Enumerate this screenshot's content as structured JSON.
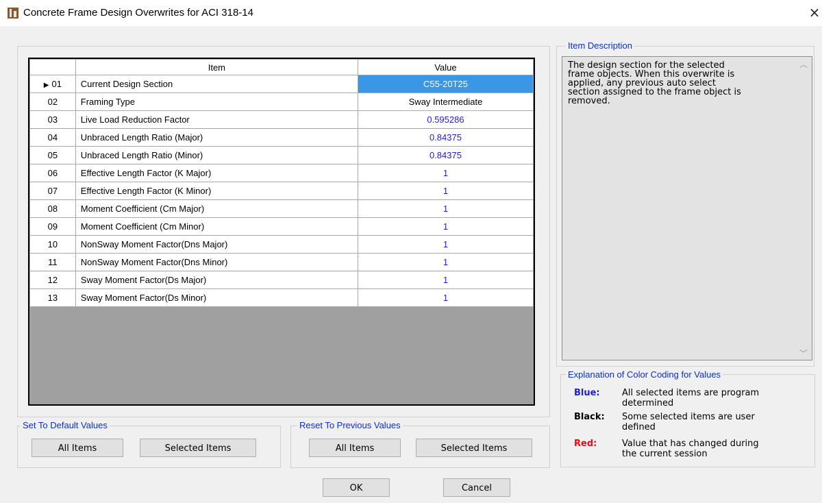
{
  "window": {
    "title": "Concrete Frame Design Overwrites for ACI 318-14",
    "close_glyph": "×"
  },
  "grid": {
    "header": {
      "num": "",
      "item": "Item",
      "value": "Value"
    },
    "selected_marker": "▶",
    "rows": [
      {
        "num": "01",
        "item": "Current Design Section",
        "value": "C55-20T25",
        "color": "blue",
        "selected": true
      },
      {
        "num": "02",
        "item": "Framing Type",
        "value": "Sway Intermediate",
        "color": "black"
      },
      {
        "num": "03",
        "item": "Live Load Reduction Factor",
        "value": "0.595286",
        "color": "blue"
      },
      {
        "num": "04",
        "item": "Unbraced Length Ratio (Major)",
        "value": "0.84375",
        "color": "blue"
      },
      {
        "num": "05",
        "item": "Unbraced Length Ratio (Minor)",
        "value": "0.84375",
        "color": "blue"
      },
      {
        "num": "06",
        "item": "Effective Length Factor (K Major)",
        "value": "1",
        "color": "blue"
      },
      {
        "num": "07",
        "item": "Effective Length Factor (K Minor)",
        "value": "1",
        "color": "blue"
      },
      {
        "num": "08",
        "item": "Moment Coefficient (Cm Major)",
        "value": "1",
        "color": "blue"
      },
      {
        "num": "09",
        "item": "Moment Coefficient (Cm Minor)",
        "value": "1",
        "color": "blue"
      },
      {
        "num": "10",
        "item": "NonSway Moment Factor(Dns Major)",
        "value": "1",
        "color": "blue"
      },
      {
        "num": "11",
        "item": "NonSway Moment Factor(Dns Minor)",
        "value": "1",
        "color": "blue"
      },
      {
        "num": "12",
        "item": "Sway Moment Factor(Ds Major)",
        "value": "1",
        "color": "blue"
      },
      {
        "num": "13",
        "item": "Sway Moment Factor(Ds Minor)",
        "value": "1",
        "color": "blue"
      }
    ]
  },
  "item_description": {
    "label": "Item Description",
    "lines": [
      "The design section for the selected",
      "frame objects.  When this overwrite is",
      "applied, any previous auto select",
      "section assigned to the frame object is",
      "removed."
    ]
  },
  "color_coding": {
    "label": "Explanation of Color Coding for Values",
    "items": [
      {
        "key": "Blue:",
        "lines": [
          "All selected items are program",
          "determined"
        ],
        "color": "#1f1fcf"
      },
      {
        "key": "Black:",
        "lines": [
          "Some selected items are user",
          "defined"
        ],
        "color": "#000000"
      },
      {
        "key": "Red:",
        "lines": [
          "Value that has changed during",
          "the current session"
        ],
        "color": "#e01010"
      }
    ]
  },
  "set_default": {
    "label": "Set To Default Values",
    "all_items": "All Items",
    "selected_items": "Selected Items"
  },
  "reset_previous": {
    "label": "Reset To Previous Values",
    "all_items": "All Items",
    "selected_items": "Selected Items"
  },
  "buttons": {
    "ok": "OK",
    "cancel": "Cancel"
  },
  "colors": {
    "group_label": "#0b2fd1",
    "selected_cell": "#3a97e6",
    "value_blue": "#1f1fcf"
  }
}
